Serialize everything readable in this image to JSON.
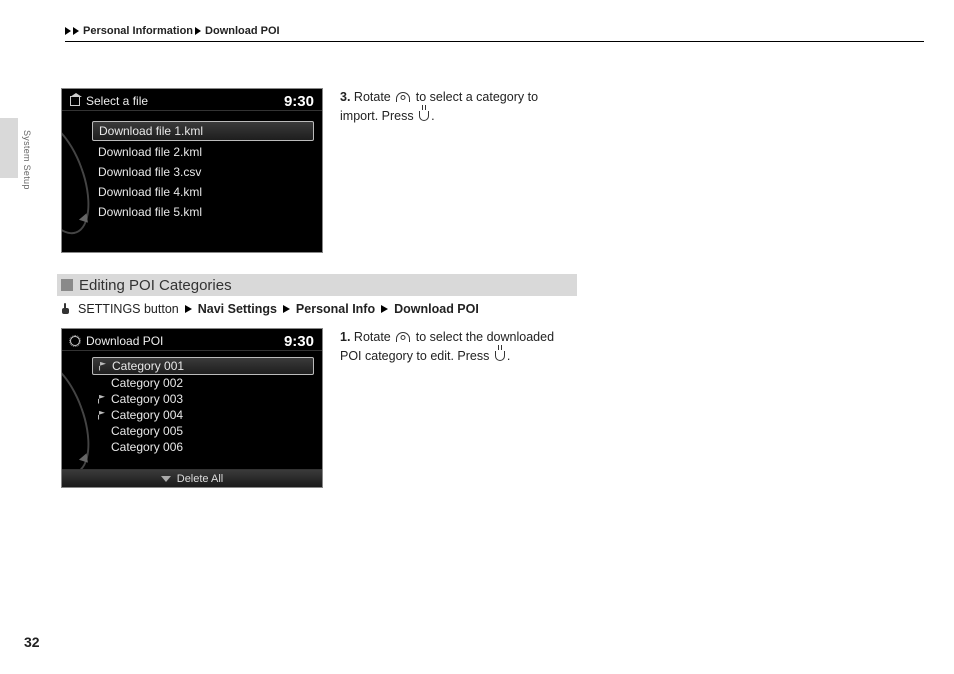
{
  "breadcrumb": {
    "item1": "Personal Information",
    "item2": "Download POI"
  },
  "side_tab": "System Setup",
  "page_number": "32",
  "screen1": {
    "title": "Select a file",
    "clock": "9:30",
    "files": [
      "Download file 1.kml",
      "Download file 2.kml",
      "Download file 3.csv",
      "Download file 4.kml",
      "Download file 5.kml"
    ]
  },
  "step3": {
    "num": "3.",
    "a": "Rotate",
    "b": "to select a category to import. Press",
    "c": "."
  },
  "section_heading": "Editing POI Categories",
  "nav_path": {
    "p0": "SETTINGS button",
    "p1": "Navi Settings",
    "p2": "Personal Info",
    "p3": "Download POI"
  },
  "screen2": {
    "title": "Download POI",
    "clock": "9:30",
    "categories": [
      "Category 001",
      "Category 002",
      "Category 003",
      "Category 004",
      "Category 005",
      "Category 006"
    ],
    "delete_label": "Delete All"
  },
  "step1b": {
    "num": "1.",
    "a": "Rotate",
    "b": "to select the downloaded POI category to edit. Press",
    "c": "."
  }
}
